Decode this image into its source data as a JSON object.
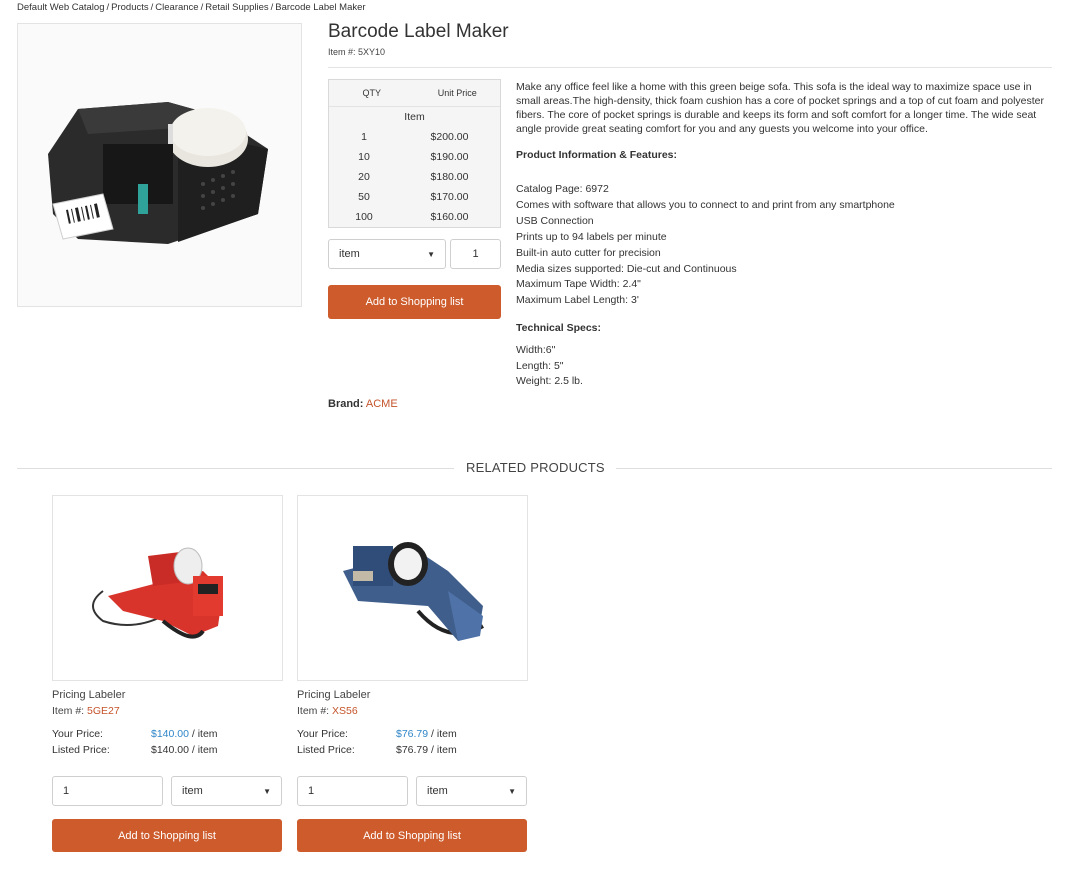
{
  "breadcrumb": [
    "Default Web Catalog",
    "Products",
    "Clearance",
    "Retail Supplies",
    "Barcode Label Maker"
  ],
  "product": {
    "title": "Barcode Label Maker",
    "item_number": "Item #: 5XY10",
    "price_table": {
      "qty_header": "QTY",
      "price_header": "Unit Price",
      "unit": "Item",
      "rows": [
        {
          "qty": "1",
          "price": "$200.00"
        },
        {
          "qty": "10",
          "price": "$190.00"
        },
        {
          "qty": "20",
          "price": "$180.00"
        },
        {
          "qty": "50",
          "price": "$170.00"
        },
        {
          "qty": "100",
          "price": "$160.00"
        }
      ]
    },
    "uom_selected": "item",
    "qty_value": "1",
    "add_button": "Add to Shopping list",
    "description": "Make any office feel like a home with this green beige sofa. This sofa is the ideal way to maximize space use in small areas.The high-density, thick foam cushion has a core of pocket springs and a top of cut foam and polyester fibers. The core of pocket springs is durable and keeps its form and soft comfort for a longer time. The wide seat angle provide great seating comfort for you and any guests you welcome into your office.",
    "features_heading": "Product Information & Features:",
    "features": [
      "Catalog Page: 6972",
      "Comes with software that allows you to connect to and print from any smartphone",
      "USB Connection",
      "Prints up to 94 labels per minute",
      "Built-in auto cutter for precision",
      "Media sizes supported: Die-cut and Continuous",
      "Maximum Tape Width: 2.4\"",
      "Maximum Label Length: 3'"
    ],
    "specs_heading": "Technical Specs:",
    "specs": [
      "Width:6\"",
      "Length: 5\"",
      "Weight: 2.5 lb."
    ],
    "brand_label": "Brand:",
    "brand_value": "ACME"
  },
  "related": {
    "title": "RELATED PRODUCTS",
    "items": [
      {
        "name": "Pricing Labeler",
        "item_label": "Item #:",
        "item_number": "5GE27",
        "your_price_label": "Your Price:",
        "your_price": "$140.00",
        "your_price_unit": " / item",
        "listed_price_label": "Listed Price:",
        "listed_price": "$140.00 / item",
        "qty_value": "1",
        "uom_selected": "item",
        "add_button": "Add to Shopping list",
        "image_icon": "red-price-labeler-gun"
      },
      {
        "name": "Pricing Labeler",
        "item_label": "Item #:",
        "item_number": "XS56",
        "your_price_label": "Your Price:",
        "your_price": "$76.79",
        "your_price_unit": " / item",
        "listed_price_label": "Listed Price:",
        "listed_price": "$76.79 / item",
        "qty_value": "1",
        "uom_selected": "item",
        "add_button": "Add to Shopping list",
        "image_icon": "blue-price-labeler-gun"
      }
    ]
  },
  "colors": {
    "accent": "#cd5b2c",
    "link": "#c4532a",
    "price_blue": "#2e86c8"
  }
}
